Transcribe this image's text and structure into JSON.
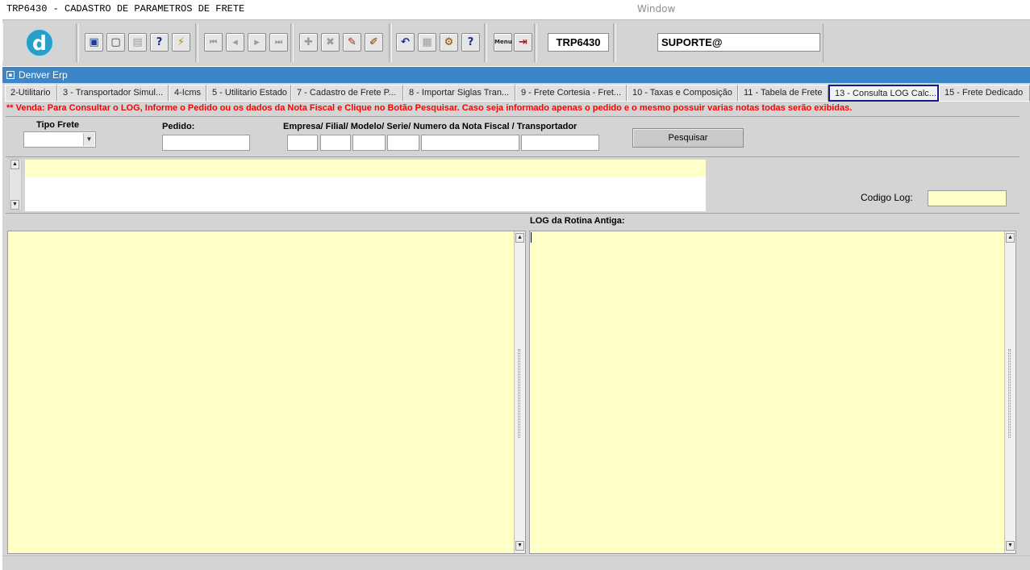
{
  "window": {
    "title": "TRP6430 - CADASTRO DE PARAMETROS DE FRETE",
    "caption": "Window"
  },
  "toolbar": {
    "program_code": "TRP6430",
    "user": "SUPORTE@",
    "logo_letter": "d",
    "buttons": [
      {
        "icon": "save-icon",
        "glyph": "▣"
      },
      {
        "icon": "window-icon",
        "glyph": "▢"
      },
      {
        "icon": "print-icon",
        "glyph": "▤"
      },
      {
        "icon": "query-help-icon",
        "glyph": "?"
      },
      {
        "icon": "execute-query-icon",
        "glyph": "⚡"
      },
      {
        "icon": "first-record-icon",
        "glyph": "⏮"
      },
      {
        "icon": "previous-record-icon",
        "glyph": "◂"
      },
      {
        "icon": "next-record-icon",
        "glyph": "▸"
      },
      {
        "icon": "last-record-icon",
        "glyph": "⏭"
      },
      {
        "icon": "insert-record-icon",
        "glyph": "✚"
      },
      {
        "icon": "delete-record-icon",
        "glyph": "✖"
      },
      {
        "icon": "edit-icon",
        "glyph": "✎"
      },
      {
        "icon": "edit-pencil-icon",
        "glyph": "✐"
      },
      {
        "icon": "undo-icon",
        "glyph": "↶"
      },
      {
        "icon": "clipboard-icon",
        "glyph": "▦"
      },
      {
        "icon": "tools-icon",
        "glyph": "⚙"
      },
      {
        "icon": "help-icon",
        "glyph": "?"
      },
      {
        "icon": "menu-icon",
        "glyph": "Menu"
      },
      {
        "icon": "exit-icon",
        "glyph": "⇥"
      }
    ]
  },
  "mdi": {
    "title": "Denver Erp"
  },
  "tabs": [
    {
      "label": "2-Utilitario",
      "active": false
    },
    {
      "label": "3 - Transportador Simul...",
      "active": false
    },
    {
      "label": "4-Icms",
      "active": false
    },
    {
      "label": "5 - Utilitario Estado",
      "active": false
    },
    {
      "label": "7 - Cadastro de Frete P...",
      "active": false
    },
    {
      "label": "8 - Importar Siglas Tran...",
      "active": false
    },
    {
      "label": "9 - Frete Cortesia - Fret...",
      "active": false
    },
    {
      "label": "10 - Taxas e Composição",
      "active": false
    },
    {
      "label": "11 - Tabela de Frete",
      "active": false
    },
    {
      "label": "13 - Consulta LOG Calc...",
      "active": true
    },
    {
      "label": "15 - Frete Dedicado",
      "active": false
    }
  ],
  "form": {
    "warning": "** Venda: Para Consultar o LOG, Informe o Pedido ou os dados da Nota Fiscal e Clique no Botão Pesquisar. Caso seja informado apenas o pedido e o mesmo possuir varias notas todas serão exibidas.",
    "tipo_frete_label": "Tipo Frete",
    "tipo_frete_value": "",
    "pedido_label": "Pedido:",
    "pedido_value": "",
    "nota_fiscal_label": "Empresa/ Filial/ Modelo/ Serie/ Numero da Nota Fiscal / Transportador",
    "empresa_value": "",
    "filial_value": "",
    "modelo_value": "",
    "serie_value": "",
    "numero_nf_value": "",
    "transportador_value": "",
    "search_button": "Pesquisar",
    "codigo_log_label": "Codigo Log:",
    "codigo_log_value": "",
    "log_rotina_antiga_label": "LOG da Rotina Antiga:",
    "log_new_text": "",
    "log_old_text": ""
  },
  "colors": {
    "toolbar_bg": "#d4d4d4",
    "mdi_title_bg": "#3b86c9",
    "field_yellow": "#ffffc8",
    "warning_red": "#ff0000",
    "active_tab_border": "#1a1a8e"
  }
}
